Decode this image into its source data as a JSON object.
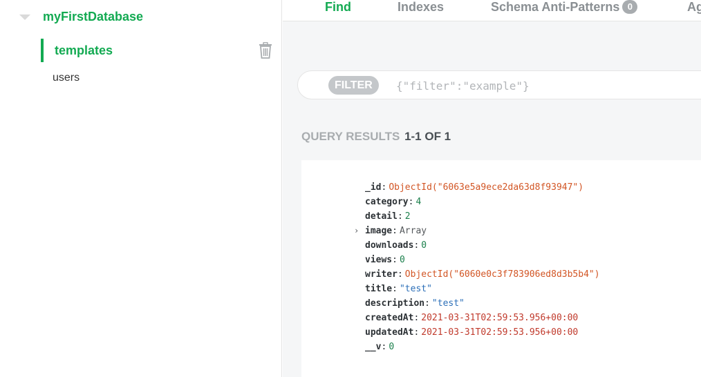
{
  "sidebar": {
    "database": "myFirstDatabase",
    "collections": [
      {
        "name": "templates",
        "active": true
      },
      {
        "name": "users",
        "active": false
      }
    ]
  },
  "tabs": {
    "find": "Find",
    "indexes": "Indexes",
    "schema": "Schema Anti-Patterns",
    "schema_count": "0",
    "aggregation": "Ag"
  },
  "filter": {
    "label": "FILTER",
    "placeholder": "{\"filter\":\"example\"}"
  },
  "results": {
    "label": "QUERY RESULTS",
    "count": "1-1 OF 1"
  },
  "document": {
    "fields": [
      {
        "key": "_id",
        "value": "ObjectId(\"6063e5a9ece2da63d8f93947\")",
        "type": "oid"
      },
      {
        "key": "category",
        "value": "4",
        "type": "num"
      },
      {
        "key": "detail",
        "value": "2",
        "type": "num"
      },
      {
        "key": "image",
        "value": "Array",
        "type": "arr"
      },
      {
        "key": "downloads",
        "value": "0",
        "type": "num"
      },
      {
        "key": "views",
        "value": "0",
        "type": "num"
      },
      {
        "key": "writer",
        "value": "ObjectId(\"6060e0c3f783906ed8d3b5b4\")",
        "type": "oid"
      },
      {
        "key": "title",
        "value": "\"test\"",
        "type": "str"
      },
      {
        "key": "description",
        "value": "\"test\"",
        "type": "str"
      },
      {
        "key": "createdAt",
        "value": "2021-03-31T02:59:53.956+00:00",
        "type": "date"
      },
      {
        "key": "updatedAt",
        "value": "2021-03-31T02:59:53.956+00:00",
        "type": "date"
      },
      {
        "key": "__v",
        "value": "0",
        "type": "num"
      }
    ]
  },
  "icons": {
    "collapse": "caret-down-icon",
    "delete": "trash-icon",
    "expand": "chevron-right-icon"
  },
  "colors": {
    "accent": "#13aa52",
    "objectid": "#d25524",
    "number": "#1a7f4b",
    "string": "#2c6fb8",
    "date": "#c0392b"
  }
}
